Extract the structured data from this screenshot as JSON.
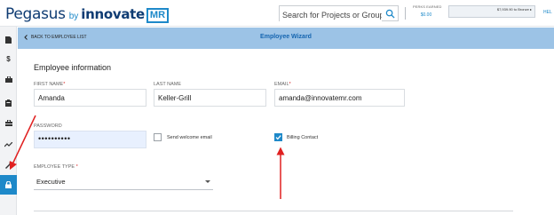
{
  "header": {
    "logo_pegasus": "Pegasus",
    "logo_by": "by",
    "logo_innovate": "innovate",
    "logo_mr": "MR",
    "search_placeholder": "Search for Projects or Groups",
    "perks_label": "PERKS EARNED",
    "perks_value": "$0.00",
    "progress_text": "$7,939.90 to Bronze",
    "progress_fraction": 0.0,
    "help_text": "HEL"
  },
  "sidebar": {
    "items": [
      {
        "icon": "document-icon",
        "glyph": "▮"
      },
      {
        "icon": "dollar-icon",
        "glyph": "$"
      },
      {
        "icon": "briefcase-icon",
        "glyph": "▣"
      },
      {
        "icon": "clipboard-icon",
        "glyph": "▤"
      },
      {
        "icon": "bag-icon",
        "glyph": "▣"
      },
      {
        "icon": "chart-icon",
        "glyph": "〰"
      },
      {
        "icon": "tools-icon",
        "glyph": "✂"
      },
      {
        "icon": "lock-icon",
        "glyph": "🔒"
      }
    ]
  },
  "wizard": {
    "back_label": "BACK TO EMPLOYEE LIST",
    "title": "Employee Wizard"
  },
  "form": {
    "section_title": "Employee information",
    "first_name_label": "FIRST NAME",
    "first_name_value": "Amanda",
    "last_name_label": "LAST NAME",
    "last_name_value": "Keller-Grill",
    "email_label": "EMAIL",
    "email_value": "amanda@innovatemr.com",
    "password_label": "PASSWORD",
    "password_value": "••••••••••",
    "welcome_email_label": "Send welcome email",
    "welcome_email_checked": false,
    "billing_contact_label": "Billing Contact",
    "billing_contact_checked": true,
    "employee_type_label": "EMPLOYEE TYPE",
    "employee_type_value": "Executive",
    "required_marker": "*"
  },
  "colors": {
    "brand_navy": "#0f3c73",
    "accent_blue": "#1e89c9",
    "header_band": "#9cc3e6",
    "annotation_red": "#e02020"
  }
}
